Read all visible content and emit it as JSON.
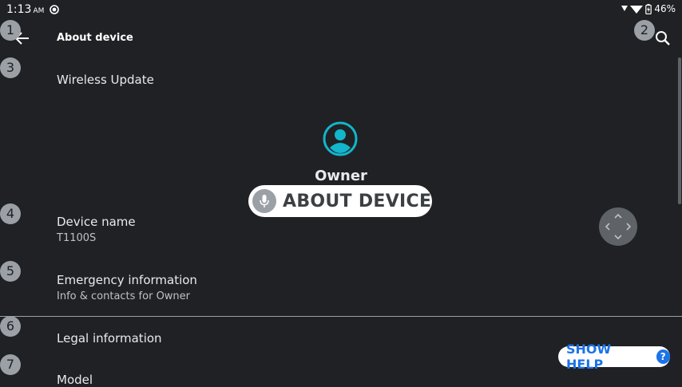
{
  "status": {
    "time": "1:13",
    "ampm": "AM",
    "battery": "46%"
  },
  "header": {
    "title": "About device"
  },
  "markers": [
    "1",
    "2",
    "3",
    "4",
    "5",
    "6",
    "7"
  ],
  "items": [
    {
      "title": "Wireless Update"
    },
    {
      "title": "Device name",
      "sub": "T1100S"
    },
    {
      "title": "Emergency information",
      "sub": "Info & contacts for Owner"
    },
    {
      "title": "Legal information"
    },
    {
      "title": "Model"
    }
  ],
  "owner": {
    "name": "Owner"
  },
  "voice_pill": {
    "label": "ABOUT DEVICE"
  },
  "help": {
    "label": "SHOW HELP",
    "q": "?"
  },
  "colors": {
    "accent": "#1a73e8",
    "owner_icon": "#12b5cb",
    "background": "#202124"
  }
}
